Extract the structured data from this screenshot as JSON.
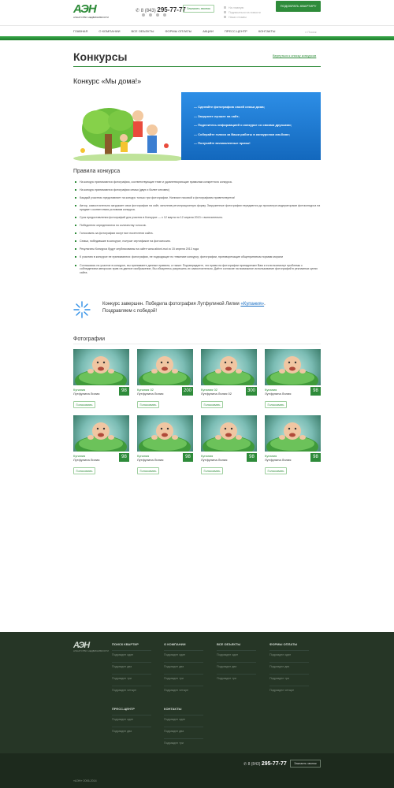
{
  "header": {
    "logo_text": "АЭН",
    "logo_sub": "АГЕНТСТВО НЕДВИЖИМОСТИ",
    "phone_prefix": "8 (843)",
    "phone_number": "295-77-77",
    "callback_label": "Заказать звонок",
    "top_links": [
      "На главную",
      "Подписаться на новости",
      "Наши отзывы"
    ],
    "cta_label": "ПОДОБРАТЬ КВАРТИРУ"
  },
  "nav": {
    "items": [
      "Главная",
      "О компании",
      "Все объекты",
      "Формы оплаты",
      "Акции",
      "Пресс-центр",
      "Контакты"
    ],
    "search_placeholder": "Поиск"
  },
  "page": {
    "title": "Конкурсы",
    "back_link": "Вернуться к списку конкурсов",
    "contest_title": "Конкурс «Мы дома!»"
  },
  "promo": {
    "steps": [
      "Сделайте фотографию своей семьи дома;",
      "Загрузите лучшее на сайт;",
      "Поделитесь информацией о конкурсе со своими друзьями;",
      "Соберайте голоса за Ваши работы в конкурсном альбоме;",
      "Получайте великолепные призы!"
    ]
  },
  "rules": {
    "title": "Правила конкурса",
    "items": [
      "На конкурс принимаются фотографии, соответствующие теме и удовлетворяющие правилам конкретного конкурса.",
      "На конкурс принимаются фотографии семьи (двух и более человек)",
      "Каждый участник представляет на конкурс только три фотографии. Наличие ноковой к фотографиям приветствуется!",
      "Автор, самостоятельно загружает свои фотографии на сайт, заполнив регистрационную форму. Загруженные фотографии передаются до просмотра модераторами фотоконкурса на предмет соответствия условиям конкурса.",
      "Срок предоставления фотографий для участия в Конкурсе — с 12 марта по 12 апреля 2013 г. включительно.",
      "Победители определяются по количеству голосов.",
      "Голосовать за фотографии могут все посетители сайта.",
      "Семьи, победившие в конкурсе, получат сертификат на фотосессию.",
      "Результаты Конкурса будут опубликованы на сайте www.aktoni-rsoi.ru 15 апреля 2013 года",
      "К участию в конкурсе не принимаются: фотографии, не подходящие по тематике конкурсу; фотографии, противоречащие общепринятым нормам морали",
      "Соглашаясь на участие в конкурсе, вы принимаете данные правила, а также: Подтверждаете, что права на фотографии принадлежат Вам и если возникнут проблемы с соблюдением авторских прав на данное изображение, Вы обязуетесь разрешать их самостоятельно. Даёте согласие на возможное использование фотографий в рекламных целях сайта."
    ]
  },
  "result": {
    "line1": "Конкурс завершен. Победила фотография Лутфулиной Лилии ",
    "link": "«Купания»",
    "line1_end": ".",
    "line2": "Поздравляем с победой!"
  },
  "photos": {
    "title": "Фотографии",
    "vote_label": "Голосовать",
    "items": [
      {
        "name": "Купания",
        "author": "Лутфулина Лилия",
        "votes": "98"
      },
      {
        "name": "Купания 02",
        "author": "Лутфулина Лилия",
        "votes": "200"
      },
      {
        "name": "Купания 02",
        "author": "Лутфулина Лилия 02",
        "votes": "300"
      },
      {
        "name": "Купания",
        "author": "Лутфулина Лилия",
        "votes": "98"
      },
      {
        "name": "Купания",
        "author": "Лутфулина Лилия",
        "votes": "98"
      },
      {
        "name": "Купания",
        "author": "Лутфулина Лилия",
        "votes": "98"
      },
      {
        "name": "Купания",
        "author": "Лутфулина Лилия",
        "votes": "98"
      },
      {
        "name": "Купания",
        "author": "Лутфулина Лилия",
        "votes": "98"
      }
    ]
  },
  "footer": {
    "logo_text": "АЭН",
    "logo_sub": "АГЕНТСТВО НЕДВИЖИМОСТИ",
    "columns": [
      {
        "title": "Поиск квартир",
        "items": [
          "Подраздел один",
          "Подраздел два",
          "Подраздел три",
          "Подраздел четыре"
        ]
      },
      {
        "title": "О компании",
        "items": [
          "Подраздел один",
          "Подраздел два",
          "Подраздел три",
          "Подраздел четыре"
        ]
      },
      {
        "title": "Все объекты",
        "items": [
          "Подраздел один",
          "Подраздел два",
          "Подраздел три"
        ]
      },
      {
        "title": "Формы оплаты",
        "items": [
          "Подраздел один",
          "Подраздел два",
          "Подраздел три",
          "Подраздел четыре"
        ]
      },
      {
        "title": "Пресс-центр",
        "items": [
          "Подраздел один",
          "Подраздел два"
        ]
      },
      {
        "title": "Контакты",
        "items": [
          "Подраздел один",
          "Подраздел два",
          "Подраздел три"
        ]
      }
    ],
    "phone_prefix": "8 (843)",
    "phone_number": "295-77-77",
    "callback_label": "Заказать звонок",
    "copyright": "«АЭН» 2006-2014"
  }
}
